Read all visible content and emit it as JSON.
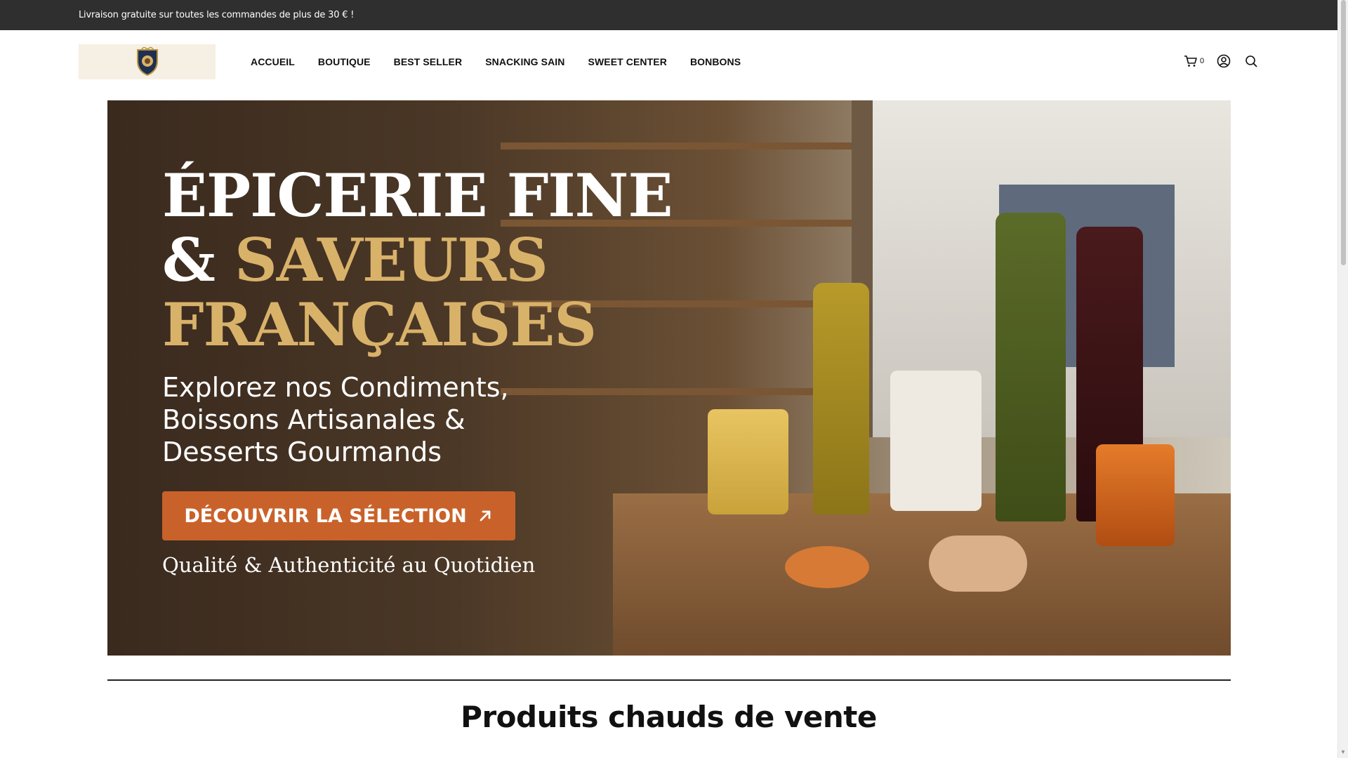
{
  "announcement": {
    "text": "Livraison gratuite sur toutes les commandes de plus de 30 € !"
  },
  "header": {
    "nav": [
      {
        "label": "ACCUEIL"
      },
      {
        "label": "BOUTIQUE"
      },
      {
        "label": "BEST SELLER"
      },
      {
        "label": "SNACKING SAIN"
      },
      {
        "label": "SWEET CENTER"
      },
      {
        "label": "BONBONS"
      }
    ],
    "cart_count": "0",
    "icons": [
      "cart-icon",
      "account-icon",
      "search-icon"
    ]
  },
  "hero": {
    "title_line1": "ÉPICERIE FINE",
    "title_amp": "&",
    "title_line2": "SAVEURS",
    "title_line3": "FRANÇAISES",
    "subtitle_line1": "Explorez nos Condiments,",
    "subtitle_line2": "Boissons Artisanales &",
    "subtitle_line3": "Desserts Gourmands",
    "cta_label": "DÉCOUVRIR LA SÉLECTION",
    "tagline": "Qualité & Authenticité au Quotidien",
    "accent_color": "#c9622a",
    "gold_color": "#d9b26a"
  },
  "section": {
    "title": "Produits chauds de vente"
  }
}
